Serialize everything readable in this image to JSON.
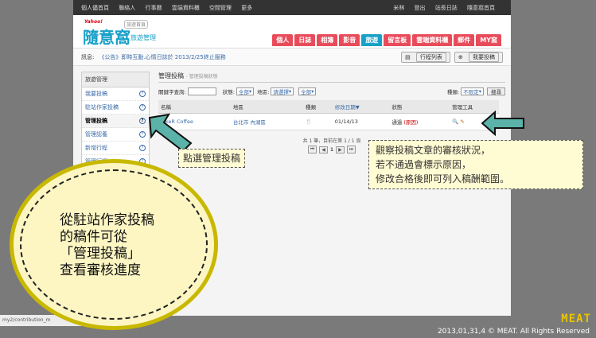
{
  "topbar": {
    "left": [
      "個人儘首頁",
      "聯絡人",
      "行事曆",
      "雲端資料櫃",
      "空間管理",
      "更多"
    ],
    "right": [
      "米林",
      "登出",
      "站長日誌",
      "隨意窩首頁"
    ]
  },
  "logo": {
    "yahoo": "Yahoo!",
    "name": "隨意窩",
    "tag": "旅遊首頁",
    "sub": "旅遊管理"
  },
  "nav": [
    {
      "label": "個人",
      "color": "#e84c5b"
    },
    {
      "label": "日誌",
      "color": "#e84c5b"
    },
    {
      "label": "相簿",
      "color": "#e84c5b"
    },
    {
      "label": "影音",
      "color": "#e84c5b"
    },
    {
      "label": "旅遊",
      "color": "#17a0c8"
    },
    {
      "label": "留言板",
      "color": "#e84c5b"
    },
    {
      "label": "雲端資料櫃",
      "color": "#e84c5b"
    },
    {
      "label": "郵件",
      "color": "#e84c5b"
    },
    {
      "label": "MY窩",
      "color": "#e84c5b"
    }
  ],
  "notice": {
    "label": "訊息:",
    "message": "《公告》即時互動.心情日誌於 2013/2/25終止服務",
    "btn_itinerary": "行程列表",
    "btn_favorites": "我要投稿"
  },
  "sidebar": {
    "title": "旅遊管理",
    "items": [
      {
        "label": "我要投稿",
        "active": false
      },
      {
        "label": "駐站作家投稿",
        "active": false
      },
      {
        "label": "管理投稿",
        "active": true
      },
      {
        "label": "管理認養",
        "active": false
      },
      {
        "label": "新增行程",
        "active": false
      },
      {
        "label": "管理行程",
        "active": false
      }
    ]
  },
  "main": {
    "heading": "管理投稿",
    "breadcrumb": "- 管理投稿狀態",
    "filter": {
      "keyword_label": "關鍵字查詢:",
      "status_label": "狀態:",
      "status_value": "全部",
      "area_label": "地區:",
      "area_value": "請選擇",
      "area_value2": "全部",
      "type_label": "種類:",
      "type_value": "不限定",
      "search_btn": "搜尋"
    },
    "columns": [
      "名稱",
      "地區",
      "種類",
      "修改日期▼",
      "狀態",
      "管理工具"
    ],
    "rows": [
      {
        "name": "JokeR Coffee",
        "area": "台北市 內湖區",
        "type_icon": "🍴",
        "date": "01/14/13",
        "status": "通過",
        "status_note": "(原因)"
      }
    ],
    "pager_text": "共 1 筆，目前在第 1 / 1 頁",
    "pager_page": "1"
  },
  "callouts": {
    "click_manage": "點選管理投稿",
    "review_line1": "觀察投稿文章的審核狀況，",
    "review_line2": "若不通過會標示原因，",
    "review_line3": "修改合格後即可列入稿酬範圍。"
  },
  "bubble": {
    "line1": "從駐站作家投稿",
    "line2": "的稿件可從",
    "line3": "「管理投稿」",
    "line4": "查看審核進度"
  },
  "status_url": "my2/contribution_m",
  "watermark": "MEAT",
  "copyright": "2013,01,31,4 © MEAT. All Rights Reserved"
}
